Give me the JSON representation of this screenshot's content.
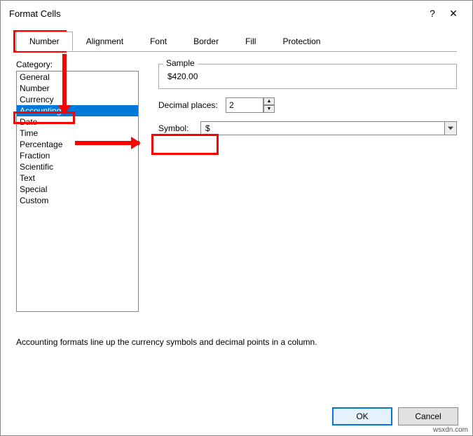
{
  "title": "Format Cells",
  "titlebar": {
    "help": "?",
    "close": "✕"
  },
  "tabs": [
    {
      "label": "Number",
      "active": true
    },
    {
      "label": "Alignment",
      "active": false
    },
    {
      "label": "Font",
      "active": false
    },
    {
      "label": "Border",
      "active": false
    },
    {
      "label": "Fill",
      "active": false
    },
    {
      "label": "Protection",
      "active": false
    }
  ],
  "category_label": "Category:",
  "categories": [
    "General",
    "Number",
    "Currency",
    "Accounting",
    "Date",
    "Time",
    "Percentage",
    "Fraction",
    "Scientific",
    "Text",
    "Special",
    "Custom"
  ],
  "selected_category_index": 3,
  "sample": {
    "legend": "Sample",
    "value": "$420.00"
  },
  "decimal": {
    "label": "Decimal places:",
    "value": "2"
  },
  "symbol": {
    "label": "Symbol:",
    "value": "$"
  },
  "description": "Accounting formats line up the currency symbols and decimal points in a column.",
  "buttons": {
    "ok": "OK",
    "cancel": "Cancel"
  },
  "watermark": "wsxdn.com"
}
